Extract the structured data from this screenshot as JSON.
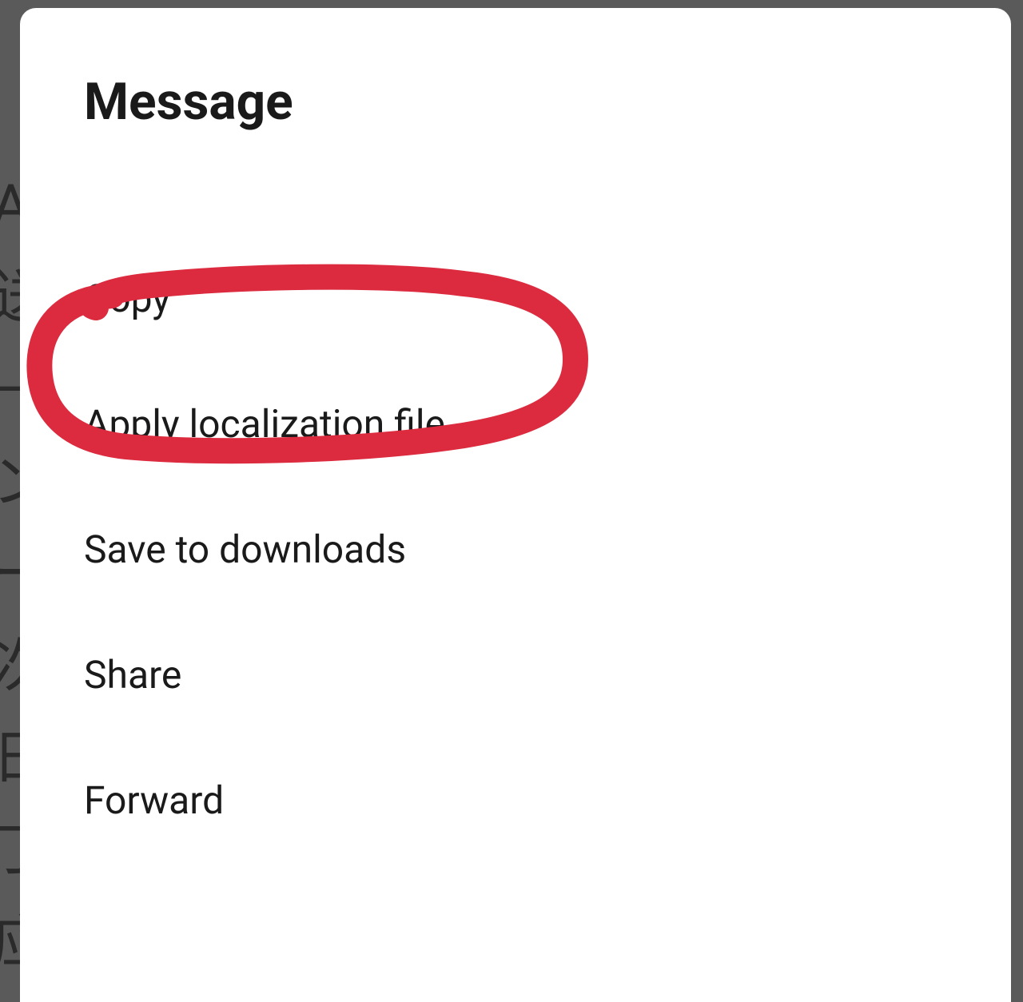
{
  "modal": {
    "title": "Message",
    "items": [
      "Copy",
      "Apply localization file",
      "Save to downloads",
      "Share",
      "Forward"
    ]
  },
  "annotation": {
    "color": "#dc2b3f",
    "target_index": 1
  },
  "background": {
    "partial_text": [
      "A",
      "送",
      "—",
      "ン",
      "ー",
      "次",
      "日",
      "丁",
      "应"
    ]
  }
}
